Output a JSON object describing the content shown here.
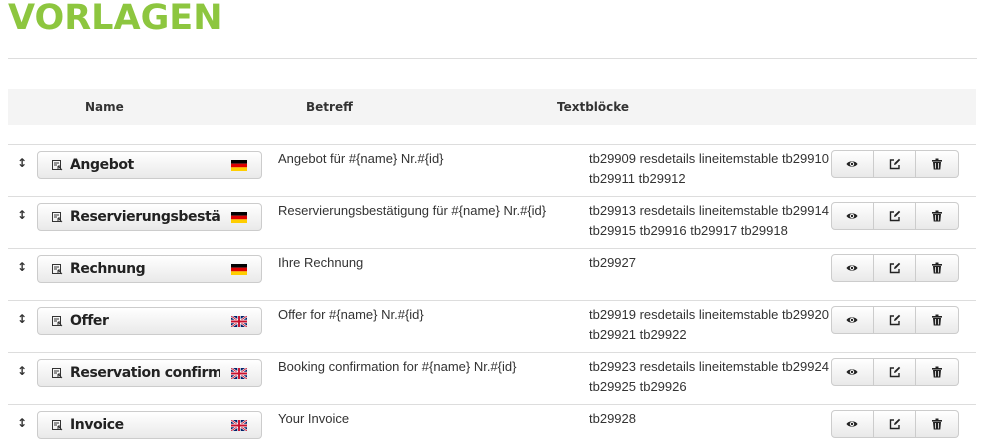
{
  "page": {
    "title": "VORLAGEN"
  },
  "table": {
    "headers": {
      "name": "Name",
      "subject": "Betreff",
      "blocks": "Textblöcke"
    },
    "rows": [
      {
        "name": "Angebot",
        "lang": "de",
        "subject": "Angebot für #{name} Nr.#{id}",
        "blocks": "tb29909 resdetails lineitemstable tb29910 tb29911 tb29912"
      },
      {
        "name": "Reservierungsbestätig",
        "lang": "de",
        "subject": "Reservierungsbestätigung für #{name} Nr.#{id}",
        "blocks": "tb29913 resdetails lineitemstable tb29914 tb29915 tb29916 tb29917 tb29918"
      },
      {
        "name": "Rechnung",
        "lang": "de",
        "subject": "Ihre Rechnung",
        "blocks": "tb29927"
      },
      {
        "name": "Offer",
        "lang": "en",
        "subject": "Offer for #{name} Nr.#{id}",
        "blocks": "tb29919 resdetails lineitemstable tb29920 tb29921 tb29922"
      },
      {
        "name": "Reservation confirmati",
        "lang": "en",
        "subject": "Booking confirmation for #{name} Nr.#{id}",
        "blocks": "tb29923 resdetails lineitemstable tb29924 tb29925 tb29926"
      },
      {
        "name": "Invoice",
        "lang": "en",
        "subject": "Your Invoice",
        "blocks": "tb29928"
      }
    ]
  },
  "icons": {
    "drag": "drag-handle-icon",
    "template": "template-icon",
    "flag_de": "flag-de-icon",
    "flag_en": "flag-uk-icon",
    "preview": "eye-icon",
    "edit": "edit-icon",
    "delete": "trash-icon"
  },
  "colors": {
    "title": "#8dc63f",
    "header_bg": "#f4f4f4",
    "border": "#dddddd"
  }
}
